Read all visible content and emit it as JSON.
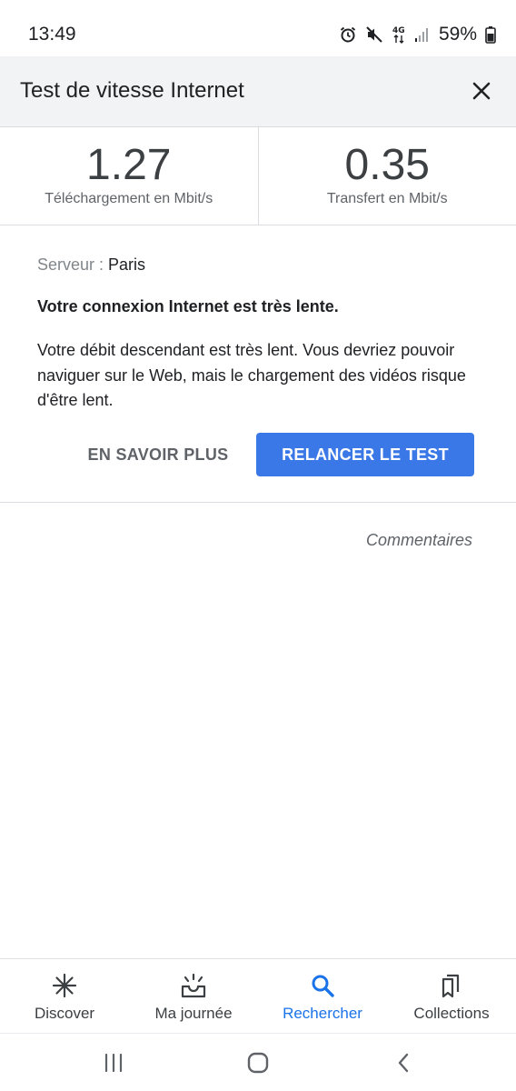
{
  "status": {
    "time": "13:49",
    "network": "4G",
    "battery": "59%"
  },
  "header": {
    "title": "Test de vitesse Internet"
  },
  "metrics": [
    {
      "value": "1.27",
      "label": "Téléchargement en Mbit/s"
    },
    {
      "value": "0.35",
      "label": "Transfert en Mbit/s"
    }
  ],
  "result": {
    "server_key": "Serveur : ",
    "server_value": "Paris",
    "verdict": "Votre connexion Internet est très lente.",
    "description": "Votre débit descendant est très lent. Vous devriez pouvoir naviguer sur le Web, mais le chargement des vidéos risque d'être lent.",
    "learn_more": "EN SAVOIR PLUS",
    "rerun": "RELANCER LE TEST"
  },
  "feedback": "Commentaires",
  "bottom_nav": {
    "items": [
      {
        "label": "Discover",
        "icon": "discover-asterisk-icon"
      },
      {
        "label": "Ma journée",
        "icon": "sunrise-icon"
      },
      {
        "label": "Rechercher",
        "icon": "search-icon"
      },
      {
        "label": "Collections",
        "icon": "collections-icon"
      }
    ],
    "active_color": "#1a73e8"
  },
  "colors": {
    "accent": "#3b78e7",
    "header_bg": "#f1f3f4"
  }
}
